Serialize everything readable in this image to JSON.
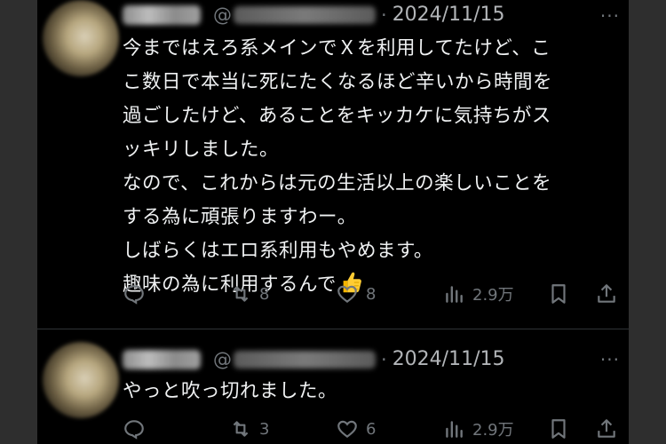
{
  "posts": [
    {
      "handle_prefix": "@",
      "separator": "·",
      "date": "2024/11/15",
      "more": "···",
      "lines": [
        "今まではえろ系メインでＸを利用してたけど、こ",
        "こ数日で本当に死にたくなるほど辛いから時間を",
        "過ごしたけど、あることをキッカケに気持ちがス",
        "ッキリしました。",
        "なので、これからは元の生活以上の楽しいことを",
        "する為に頑張りますわー。",
        "しばらくはエロ系利用もやめます。",
        "趣味の為に利用するんで"
      ],
      "emoji_icon": "thumbs-up-icon",
      "actions": {
        "reposts": "8",
        "likes": "8",
        "views": "2.9万"
      }
    },
    {
      "handle_prefix": "@",
      "separator": "·",
      "date": "2024/11/15",
      "more": "···",
      "lines": [
        "やっと吹っ切れました。"
      ],
      "actions": {
        "reposts": "3",
        "likes": "6",
        "views": "2.9万"
      }
    }
  ],
  "colors": {
    "background": "#000000",
    "text": "#e7e9ea",
    "secondary": "#71767b"
  }
}
